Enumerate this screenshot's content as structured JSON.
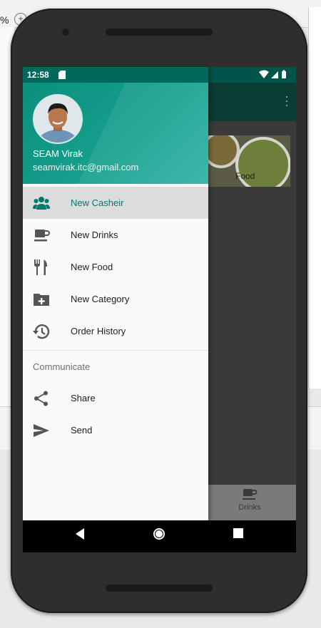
{
  "ide": {
    "zoom_fragment": "%"
  },
  "status": {
    "time": "12:58"
  },
  "drawer": {
    "user_name": "SEAM Virak",
    "user_email": "seamvirak.itc@gmail.com",
    "menu": [
      {
        "label": "New Casheir",
        "icon": "people-icon",
        "active": true
      },
      {
        "label": "New Drinks",
        "icon": "coffee-cup-icon"
      },
      {
        "label": "New Food",
        "icon": "fork-knife-icon"
      },
      {
        "label": "New Category",
        "icon": "add-folder-icon"
      },
      {
        "label": "Order History",
        "icon": "history-icon"
      }
    ],
    "section_title": "Communicate",
    "communicate": [
      {
        "label": "Share",
        "icon": "share-icon"
      },
      {
        "label": "Send",
        "icon": "send-icon"
      }
    ]
  },
  "app": {
    "card_label": "Food",
    "bottom_nav_label": "Drinks"
  },
  "colors": {
    "accent": "#00796b",
    "header": "#16a08d"
  }
}
